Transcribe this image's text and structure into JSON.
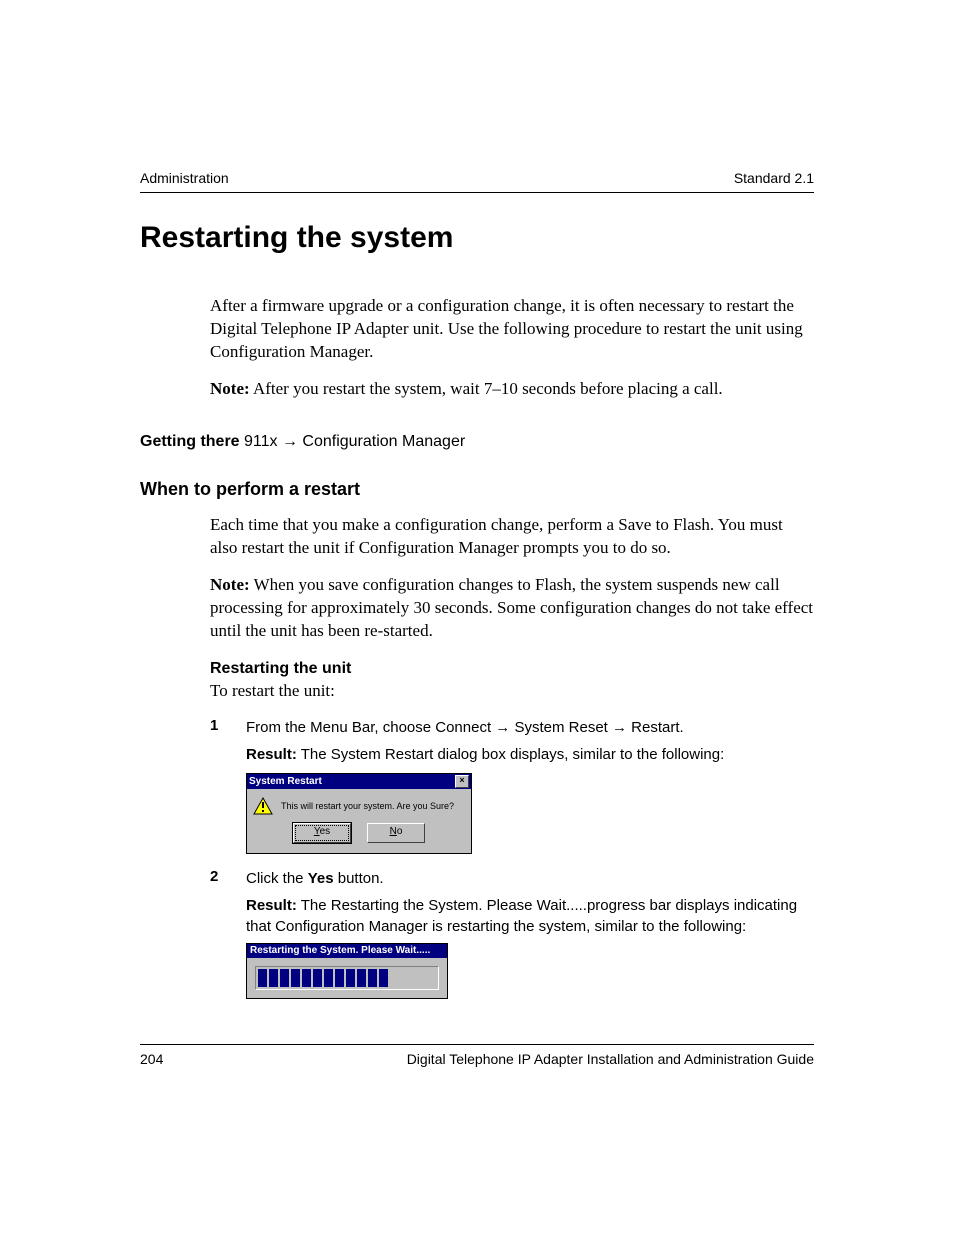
{
  "header": {
    "left": "Administration",
    "right": "Standard 2.1"
  },
  "title": "Restarting the system",
  "intro": "After a firmware upgrade or a configuration change, it is often necessary to restart the Digital Telephone IP Adapter unit. Use the following procedure to restart the unit using Configuration Manager.",
  "note1_label": "Note:",
  "note1_text": " After you restart the system, wait 7–10 seconds before placing a call.",
  "getting_there": {
    "label": "Getting there",
    "path": "  911x → Configuration Manager"
  },
  "subhead1": "When to perform a restart",
  "para2": "Each time that you make a configuration change, perform a Save to Flash. You must also restart the unit if Configuration Manager prompts you to do so.",
  "note2_label": "Note:",
  "note2_text": " When you save configuration changes to Flash, the system suspends new call processing for approximately 30 seconds. Some configuration changes do not take effect until the unit has been re-started.",
  "minihead": "Restarting the unit",
  "para3": "To restart the unit:",
  "step1": {
    "num": "1",
    "text": "From the Menu Bar, choose Connect → System Reset → Restart.",
    "result_label": "Result:",
    "result_text": " The System Restart dialog box displays, similar to the following:"
  },
  "dialog1": {
    "title": "System Restart",
    "message": "This will restart your system. Are you Sure?",
    "yes_u": "Y",
    "yes_rest": "es",
    "no_u": "N",
    "no_rest": "o",
    "close": "×"
  },
  "step2": {
    "num": "2",
    "text_pre": "Click the ",
    "text_bold": "Yes",
    "text_post": " button.",
    "result_label": "Result:",
    "result_text": " The Restarting the System. Please Wait.....progress bar displays indicating that Configuration Manager is restarting the system, similar to the following:"
  },
  "dialog2": {
    "title": "Restarting the System. Please Wait....."
  },
  "footer": {
    "page": "204",
    "title": "Digital Telephone IP Adapter Installation and Administration Guide"
  }
}
